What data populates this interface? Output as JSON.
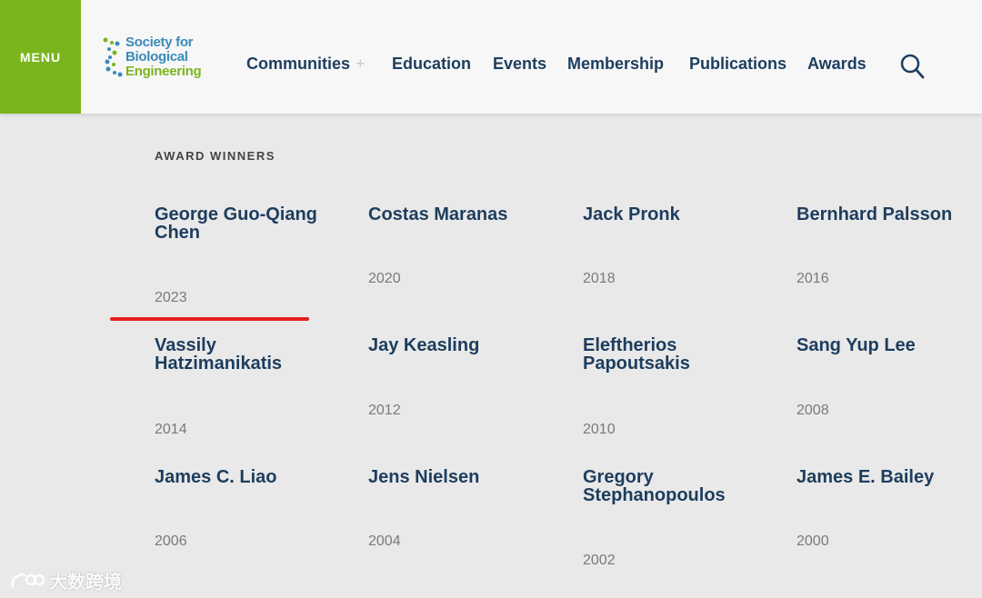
{
  "header": {
    "menu_label": "MENU",
    "logo": {
      "line1": "Society for",
      "line2": "Biological",
      "line3": "Engineering"
    },
    "nav": [
      {
        "label": "Communities",
        "has_plus": true
      },
      {
        "label": "Education"
      },
      {
        "label": "Events"
      },
      {
        "label": "Membership"
      },
      {
        "label": "Publications"
      },
      {
        "label": "Awards"
      }
    ],
    "nav_plus": "+",
    "search_icon": "search-icon"
  },
  "section": {
    "title": "AWARD WINNERS"
  },
  "winners": [
    {
      "name": "George Guo-Qiang Chen",
      "year": "2023"
    },
    {
      "name": "Costas Maranas",
      "year": "2020"
    },
    {
      "name": "Jack Pronk",
      "year": "2018"
    },
    {
      "name": "Bernhard Palsson",
      "year": "2016"
    },
    {
      "name": "Vassily Hatzimanikatis",
      "year": "2014"
    },
    {
      "name": "Jay Keasling",
      "year": "2012"
    },
    {
      "name": "Eleftherios Papoutsakis",
      "year": "2010"
    },
    {
      "name": "Sang Yup Lee",
      "year": "2008"
    },
    {
      "name": "James C. Liao",
      "year": "2006"
    },
    {
      "name": "Jens Nielsen",
      "year": "2004"
    },
    {
      "name": "Gregory Stephanopoulos",
      "year": "2002"
    },
    {
      "name": "James E. Bailey",
      "year": "2000"
    }
  ],
  "watermark": {
    "text": "大数跨境"
  },
  "colors": {
    "menu_green": "#7ab51d",
    "nav_navy": "#1d3d5e",
    "logo_blue": "#3a8ab8",
    "annotation_red": "#e62020"
  }
}
